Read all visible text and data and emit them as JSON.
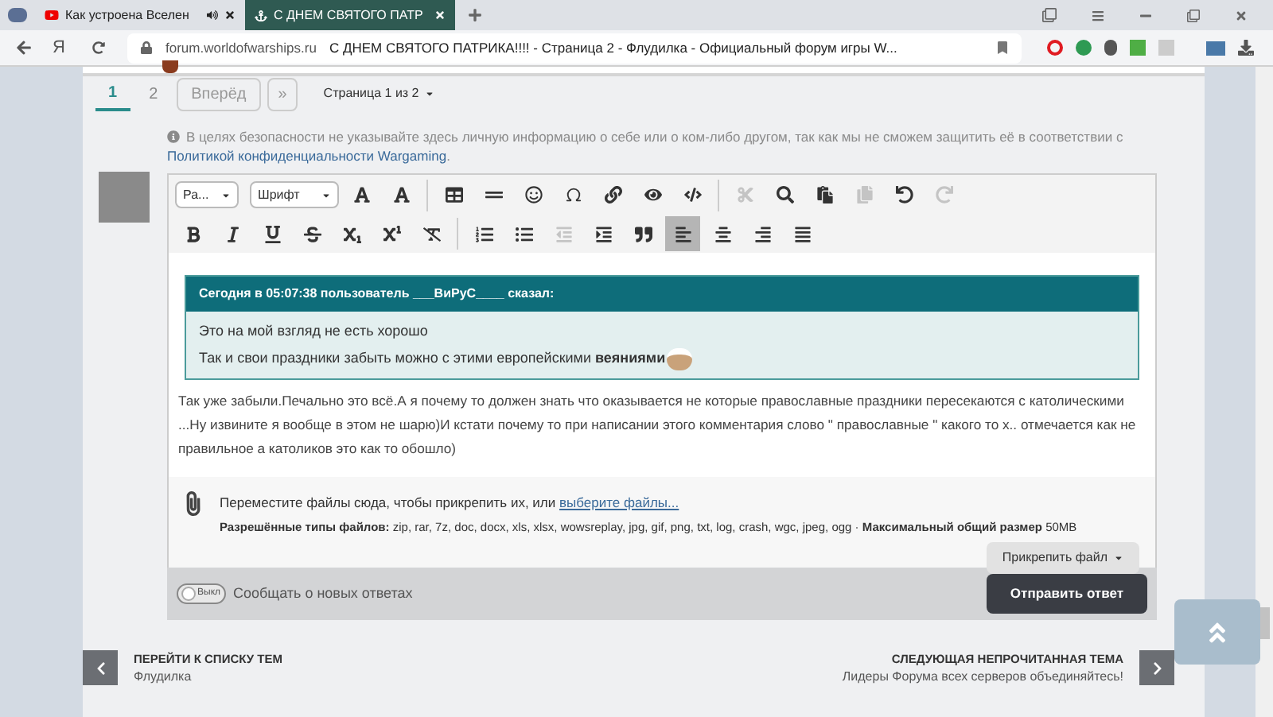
{
  "browser": {
    "tabs": [
      {
        "title": "Как устроена Вселен",
        "selected": false
      },
      {
        "title": "С ДНЕМ СВЯТОГО ПАТР",
        "selected": true
      }
    ],
    "home_label": "Я",
    "url": "forum.worldofwarships.ru",
    "page_title": "С ДНЕМ СВЯТОГО ПАТРИКА!!!! - Страница 2 - Флудилка - Официальный форум игры W..."
  },
  "pagination": {
    "pages": [
      {
        "label": "1",
        "selected": true
      },
      {
        "label": "2",
        "selected": false
      }
    ],
    "next": "Вперёд",
    "last": "»",
    "page_of": "Страница 1 из 2"
  },
  "notice": {
    "text": "В целях безопасности не указывайте здесь личную информацию о себе или о ком-либо другом, так как мы не сможем защитить её в соответствии с ",
    "link": "Политикой конфиденциальности Wargaming",
    "end": "."
  },
  "toolbar": {
    "format_dropdown": "Ра...",
    "font_dropdown": "Шрифт",
    "row_1": [
      {
        "selected": false,
        "disabled": false
      },
      {
        "selected": false,
        "disabled": false
      },
      {
        "selected": false,
        "disabled": false
      },
      {
        "selected": false,
        "disabled": false
      },
      {
        "selected": false,
        "disabled": false
      },
      {
        "selected": false,
        "disabled": false
      },
      {
        "selected": false,
        "disabled": false
      },
      {
        "selected": false,
        "disabled": false
      },
      {
        "selected": false,
        "disabled": false
      },
      {
        "selected": false,
        "disabled": true
      },
      {
        "selected": false,
        "disabled": false
      },
      {
        "selected": false,
        "disabled": false
      },
      {
        "selected": false,
        "disabled": true
      },
      {
        "selected": false,
        "disabled": false
      },
      {
        "selected": false,
        "disabled": true
      }
    ],
    "row_2": [
      {
        "selected": false,
        "disabled": false
      },
      {
        "selected": false,
        "disabled": false
      },
      {
        "selected": false,
        "disabled": false
      },
      {
        "selected": false,
        "disabled": false
      },
      {
        "selected": false,
        "disabled": false
      },
      {
        "selected": false,
        "disabled": false
      },
      {
        "selected": false,
        "disabled": false
      },
      {
        "selected": false,
        "disabled": false
      },
      {
        "selected": false,
        "disabled": false
      },
      {
        "selected": false,
        "disabled": true
      },
      {
        "selected": false,
        "disabled": false
      },
      {
        "selected": false,
        "disabled": false
      },
      {
        "selected": true,
        "disabled": false
      },
      {
        "selected": false,
        "disabled": false
      },
      {
        "selected": false,
        "disabled": false
      },
      {
        "selected": false,
        "disabled": false
      }
    ]
  },
  "quote": {
    "header": "Сегодня в 05:07:38 пользователь ___ВиРуС____ сказал:",
    "lines": [
      "Это на мой взгляд не есть хорошо",
      "Так и свои праздники забыть можно  с этими европейскими **веяниями**"
    ]
  },
  "reply_text": "Так уже забыли.Печально это всё.А я почему то должен знать что оказывается не которые православные праздники пересекаются с католическими ...Ну извините я вообще в этом не шарю)И кстати почему то при написании этого комментария слово \" православные \" какого то х.. отмечается как не правильное а католиков это как то обошло)",
  "attach": {
    "text": "Переместите файлы сюда, чтобы прикрепить их, или ",
    "link": "выберите файлы...",
    "types_label": "Разрешённые типы файлов:",
    "types": " zip, rar, 7z, doc, docx, xls, xlsx, wowsreplay, jpg, gif, png, txt, log, crash, wgc, jpeg, ogg · ",
    "size_label": "Максимальный общий размер",
    "size": " 50MB",
    "button": "Прикрепить файл"
  },
  "notify": {
    "toggle_label": "Выкл",
    "on": false,
    "label": "Сообщать о новых ответах"
  },
  "submit": "Отправить ответ",
  "bottom_nav": {
    "prev_title": "ПЕРЕЙТИ К СПИСКУ ТЕМ",
    "prev_sub": "Флудилка",
    "next_title": "СЛЕДУЮЩАЯ НЕПРОЧИТАННАЯ ТЕМА",
    "next_sub": "Лидеры Форума всех серверов объединяйтесь!"
  }
}
